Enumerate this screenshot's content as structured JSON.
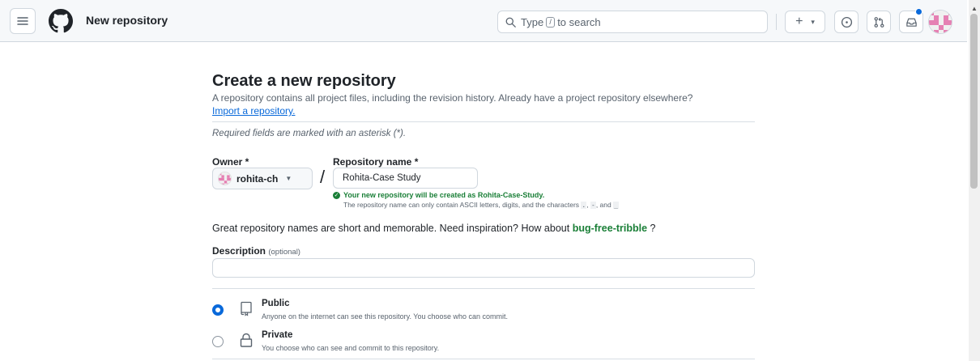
{
  "header": {
    "title": "New repository",
    "search_prefix": "Type",
    "search_key": "/",
    "search_suffix": "to search",
    "create_label": "+",
    "icons": [
      "hamburger-menu-icon",
      "github-logo-icon",
      "search-icon",
      "plus-icon",
      "issue-opened-icon",
      "git-pull-request-icon",
      "inbox-icon"
    ]
  },
  "page": {
    "title": "Create a new repository",
    "subtitle": "A repository contains all project files, including the revision history. Already have a project repository elsewhere?",
    "import_link": "Import a repository.",
    "required_note": "Required fields are marked with an asterisk (*)."
  },
  "form": {
    "owner_label": "Owner *",
    "owner_value": "rohita-ch",
    "separator": "/",
    "repo_label": "Repository name *",
    "repo_value": "Rohita-Case Study",
    "availability": "Your new repository will be created as Rohita-Case-Study.",
    "rule_prefix": "The repository name can only contain ASCII letters, digits, and the characters",
    "rule_chars": [
      ".",
      "-",
      "_"
    ],
    "rule_comma": ",",
    "rule_and": ", and",
    "inspire_text": "Great repository names are short and memorable. Need inspiration? How about",
    "inspire_suggestion": "bug-free-tribble",
    "inspire_end": "?",
    "description_label": "Description",
    "description_optional": "(optional)",
    "description_value": ""
  },
  "visibility": {
    "selected": "Public",
    "options": [
      {
        "label": "Public",
        "description": "Anyone on the internet can see this repository. You choose who can commit."
      },
      {
        "label": "Private",
        "description": "You choose who can see and commit to this repository."
      }
    ]
  },
  "colors": {
    "accent": "#0969da",
    "success": "#1a7f37",
    "border": "#d0d7de",
    "header_bg": "#f6f8fa",
    "avatar_pink": "#e580b3"
  }
}
